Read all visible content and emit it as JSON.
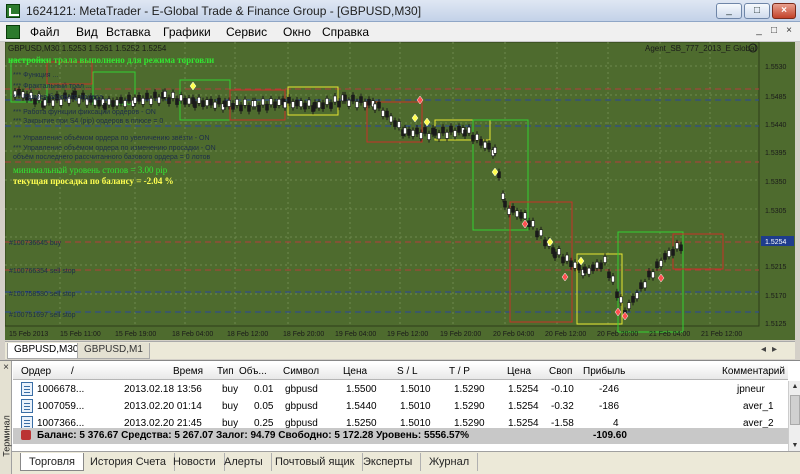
{
  "window": {
    "title": "1624121: MetaTrader - E-Global Trade & Finance Group - [GBPUSD,M30]",
    "buttons": [
      "_",
      "□",
      "×"
    ]
  },
  "menu": {
    "items": [
      "Файл",
      "Вид",
      "Вставка",
      "Графики",
      "Сервис",
      "Окно",
      "Справка"
    ],
    "mdi_buttons": [
      "_",
      "□",
      "×"
    ]
  },
  "chart": {
    "header": "GBPUSD,M30  1.5253 1.5261 1.5252 1.5254",
    "expert_label": "Agent_SB_777_2013_E Global",
    "price_labels": [
      "1.5530",
      "1.5485",
      "1.5440",
      "1.5395",
      "1.5350",
      "1.5305",
      "1.5260",
      "1.5215",
      "1.5170",
      "1.5125"
    ],
    "current_price": "1.5254",
    "time_labels": [
      "15 Feb 2013",
      "15 Feb 11:00",
      "15 Feb 19:00",
      "18 Feb 04:00",
      "18 Feb 12:00",
      "18 Feb 20:00",
      "19 Feb 04:00",
      "19 Feb 12:00",
      "19 Feb 20:00",
      "20 Feb 04:00",
      "20 Feb 12:00",
      "20 Feb 20:00",
      "21 Feb 04:00",
      "21 Feb 12:00"
    ],
    "overlay_lines": [
      "настройки трала выполнено для режима торговли",
      "*** Функция ...",
      "*** Фрактальный трал ...",
      "*** Размер базового ордера ...",
      "*** Работа функции фиксации ордеров - ON",
      "*** Закрытие при S4 (pip) ордеров в плюсе = 0",
      "*** Управление объёмом ордера по увеличению звёзти -  ON",
      "*** Управление объёмом ордера по изменению просадки -  ON",
      "объём последнего рассчитанного базового ордера =  0 лотов",
      "минимальный уровень стопов =  3.00 pip",
      "текущая просадка по балансу =  -2.04 %"
    ],
    "order_lines": [
      "#100736645 buy",
      "#100766354 sell stop",
      "#100758580 sell stop",
      "#100751697 sell stop"
    ],
    "colors": {
      "background": "#4e6b2e",
      "grid": "#6e8a4e",
      "candle": "#1a1a1a",
      "box_green": "#32d232",
      "box_yellow": "#e6e632",
      "box_red": "#c83228",
      "level_red": "#b43c3c",
      "level_blue": "#2846a0",
      "text_green": "#32e632",
      "text_yellow": "#ffff50"
    }
  },
  "chart_tabs": [
    "GBPUSD,M30",
    "GBPUSD,M1"
  ],
  "terminal": {
    "side_label": "Терминал",
    "columns": [
      "Ордер",
      "/",
      "Время",
      "Тип",
      "Объ...",
      "Символ",
      "Цена",
      "S / L",
      "T / P",
      "Цена",
      "Своп",
      "Прибыль",
      "Комментарий"
    ],
    "rows": [
      {
        "order": "1006678...",
        "time": "2013.02.18 13:56",
        "type": "buy",
        "volume": "0.01",
        "symbol": "gbpusd",
        "price": "1.5500",
        "sl": "1.5010",
        "tp": "1.5290",
        "cur": "1.5254",
        "swap": "-0.10",
        "profit": "-246",
        "comment": "jpneur"
      },
      {
        "order": "1007059...",
        "time": "2013.02.20 01:14",
        "type": "buy",
        "volume": "0.05",
        "symbol": "gbpusd",
        "price": "1.5440",
        "sl": "1.5010",
        "tp": "1.5290",
        "cur": "1.5254",
        "swap": "-0.32",
        "profit": "-186",
        "comment": "aver_1"
      },
      {
        "order": "1007366...",
        "time": "2013.02.20 21:45",
        "type": "buy",
        "volume": "0.25",
        "symbol": "gbpusd",
        "price": "1.5250",
        "sl": "1.5010",
        "tp": "1.5290",
        "cur": "1.5254",
        "swap": "-1.58",
        "profit": "4",
        "comment": "aver_2"
      }
    ],
    "balance_text": "Баланс: 5 376.67  Средства: 5 267.07  Залог: 94.79  Свободно: 5 172.28  Уровень: 5556.57%",
    "balance_profit": "-109.60"
  },
  "bottom_tabs": [
    "Торговля",
    "История Счета",
    "Новости",
    "Алерты",
    "Почтовый ящик",
    "Эксперты",
    "Журнал"
  ]
}
